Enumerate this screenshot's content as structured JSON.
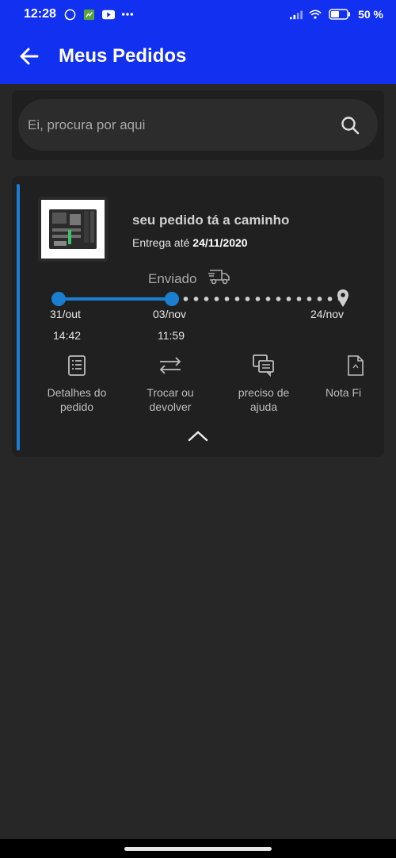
{
  "status_bar": {
    "time": "12:28",
    "battery": "50 %",
    "icons": [
      "whatsapp-icon",
      "app-icon",
      "youtube-icon",
      "more-icon",
      "signal-icon",
      "wifi-icon",
      "battery-icon"
    ]
  },
  "app_bar": {
    "title": "Meus Pedidos",
    "back_icon": "back-arrow-icon",
    "color": "#1230f0"
  },
  "search": {
    "placeholder": "Ei, procura por aqui",
    "value": "",
    "icon": "search-icon"
  },
  "order": {
    "status_title": "seu pedido tá a caminho",
    "delivery_prefix": "Entrega até",
    "delivery_date": "24/11/2020",
    "stage_label": "Enviado",
    "accent_color": "#1a7fd0",
    "tracking": [
      {
        "date": "31/out",
        "time": "14:42"
      },
      {
        "date": "03/nov",
        "time": "11:59"
      },
      {
        "date": "24/nov",
        "time": ""
      }
    ],
    "actions": [
      {
        "label": "Detalhes do\npedido",
        "icon": "list-icon"
      },
      {
        "label": "Trocar ou\ndevolver",
        "icon": "swap-icon"
      },
      {
        "label": "preciso de\najuda",
        "icon": "chat-icon"
      },
      {
        "label": "Nota Fi",
        "icon": "document-icon"
      }
    ]
  }
}
